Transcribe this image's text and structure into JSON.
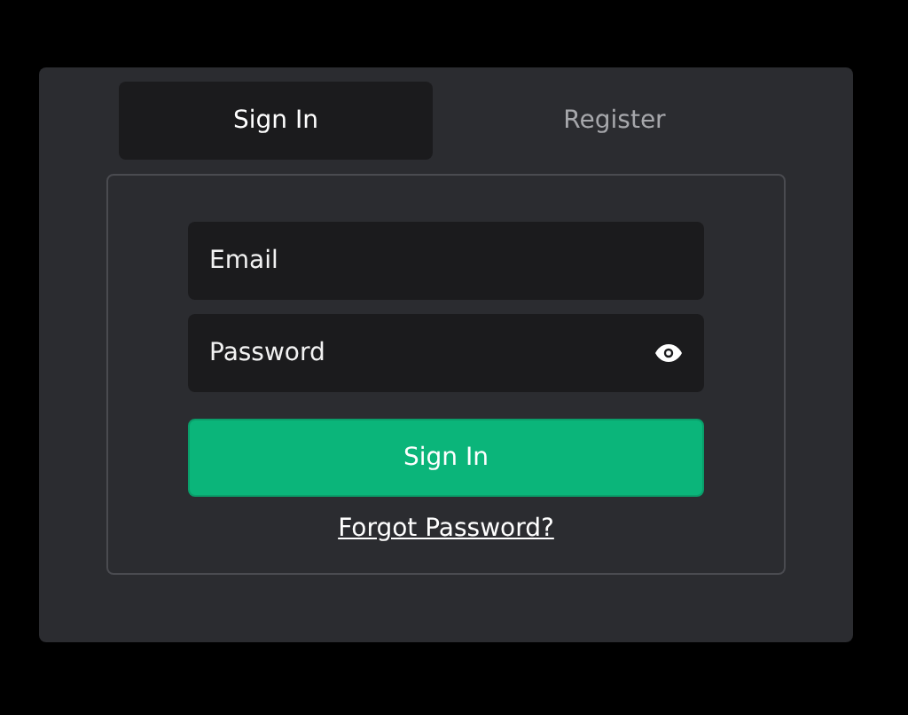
{
  "tabs": [
    {
      "label": "Sign In",
      "selected": true
    },
    {
      "label": "Register",
      "selected": false
    }
  ],
  "form": {
    "fields": [
      {
        "placeholder": "Email",
        "kind": "text"
      },
      {
        "placeholder": "Password",
        "kind": "password"
      }
    ],
    "submit": "Sign In",
    "link": "Forgot Password?"
  }
}
